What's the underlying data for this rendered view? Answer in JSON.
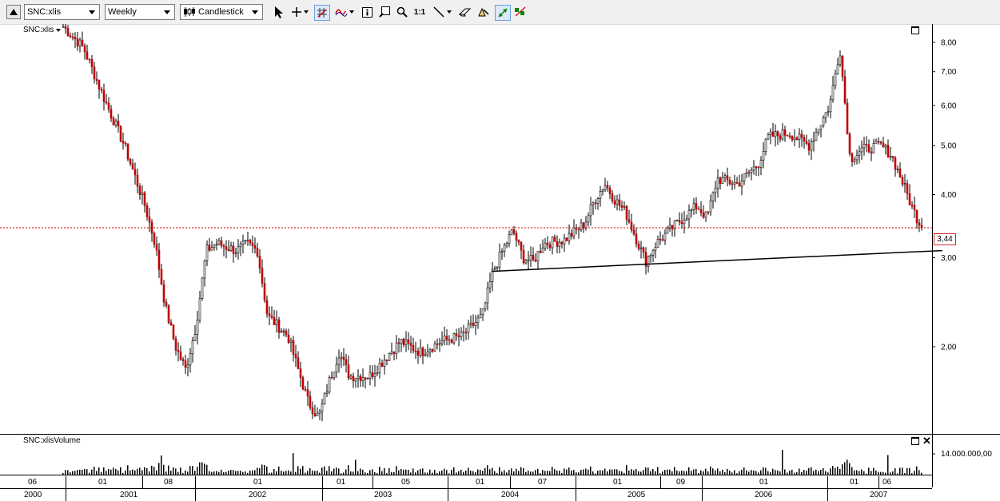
{
  "toolbar": {
    "symbol": "SNC:xlis",
    "period": "Weekly",
    "chart_style": "Candlestick",
    "ratio_label": "1:1",
    "icons": [
      "collapse-icon",
      "cursor-icon",
      "crosshair-icon",
      "grid-icon",
      "indicator-icon",
      "info-icon",
      "zoom-box-icon",
      "zoom-icon",
      "trendline-icon",
      "eraser-icon",
      "draw-tools-icon",
      "autoscale-icon",
      "chart-props-icon"
    ]
  },
  "price_pane": {
    "title": "SNC:xlis",
    "y_ticks": [
      "8,00",
      "7,00",
      "6,00",
      "5,00",
      "4,00",
      "3,00",
      "2,00"
    ],
    "last_price": "3,44"
  },
  "volume_pane": {
    "title": "SNC:xlisVolume",
    "y_tick": "14.000.000,00"
  },
  "x_axis": {
    "months": [
      "06",
      "01",
      "08",
      "01",
      "01",
      "05",
      "01",
      "07",
      "01",
      "09",
      "01",
      "01",
      "06"
    ],
    "years": [
      "2000",
      "2001",
      "2002",
      "2003",
      "2004",
      "2005",
      "2006",
      "2007"
    ]
  },
  "colors": {
    "up_candle": "#ffffff",
    "down_candle": "#c00000",
    "last_price_line": "#d00000",
    "trendline": "#000000"
  },
  "chart_data": {
    "type": "candlestick",
    "title": "",
    "xlabel": "",
    "ylabel": "",
    "scale": "log",
    "ylim": [
      1.35,
      8.7
    ],
    "interval": "weekly",
    "period": "2000-06 to 2007-07",
    "close_path": [
      [
        "2000-06",
        8.6
      ],
      [
        "2000-08",
        7.8
      ],
      [
        "2000-10",
        6.2
      ],
      [
        "2000-12",
        5.0
      ],
      [
        "2001-02",
        3.8
      ],
      [
        "2001-03",
        3.2
      ],
      [
        "2001-04",
        2.4
      ],
      [
        "2001-05",
        2.0
      ],
      [
        "2001-06",
        1.8
      ],
      [
        "2001-07",
        2.2
      ],
      [
        "2001-08",
        3.1
      ],
      [
        "2001-09",
        3.2
      ],
      [
        "2001-11",
        3.1
      ],
      [
        "2001-12",
        3.2
      ],
      [
        "2002-01",
        3.1
      ],
      [
        "2002-02",
        2.3
      ],
      [
        "2002-03",
        2.2
      ],
      [
        "2002-04",
        2.1
      ],
      [
        "2002-05",
        1.8
      ],
      [
        "2002-06",
        1.55
      ],
      [
        "2002-07",
        1.45
      ],
      [
        "2002-08",
        1.7
      ],
      [
        "2002-09",
        1.95
      ],
      [
        "2002-10",
        1.75
      ],
      [
        "2002-12",
        1.75
      ],
      [
        "2003-02",
        1.95
      ],
      [
        "2003-03",
        2.05
      ],
      [
        "2003-05",
        1.95
      ],
      [
        "2003-07",
        2.05
      ],
      [
        "2003-09",
        2.1
      ],
      [
        "2003-11",
        2.3
      ],
      [
        "2003-12",
        2.8
      ],
      [
        "2004-01",
        3.1
      ],
      [
        "2004-02",
        3.4
      ],
      [
        "2004-03",
        3.0
      ],
      [
        "2004-04",
        2.95
      ],
      [
        "2004-05",
        3.2
      ],
      [
        "2004-07",
        3.25
      ],
      [
        "2004-09",
        3.5
      ],
      [
        "2004-10",
        3.9
      ],
      [
        "2004-11",
        4.2
      ],
      [
        "2004-12",
        3.9
      ],
      [
        "2005-01",
        3.7
      ],
      [
        "2005-02",
        3.3
      ],
      [
        "2005-03",
        2.95
      ],
      [
        "2005-04",
        3.2
      ],
      [
        "2005-06",
        3.5
      ],
      [
        "2005-08",
        3.8
      ],
      [
        "2005-09",
        3.6
      ],
      [
        "2005-10",
        4.3
      ],
      [
        "2005-12",
        4.2
      ],
      [
        "2006-02",
        4.6
      ],
      [
        "2006-03",
        5.2
      ],
      [
        "2006-05",
        5.3
      ],
      [
        "2006-07",
        5.0
      ],
      [
        "2006-09",
        6.0
      ],
      [
        "2006-10",
        7.8
      ],
      [
        "2006-11",
        4.7
      ],
      [
        "2006-12",
        4.9
      ],
      [
        "2007-02",
        5.0
      ],
      [
        "2007-03",
        4.8
      ],
      [
        "2007-04",
        4.3
      ],
      [
        "2007-05",
        3.8
      ],
      [
        "2007-06",
        3.44
      ]
    ],
    "trendline": [
      [
        "2003-12",
        2.82
      ],
      [
        "2007-07",
        3.1
      ]
    ],
    "last_price": 3.44
  }
}
